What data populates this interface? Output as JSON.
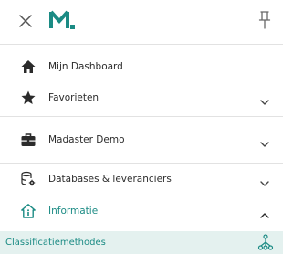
{
  "header": {
    "close_icon": "close-icon",
    "logo_icon": "madaster-logo",
    "pin_icon": "pin-icon"
  },
  "nav": {
    "dashboard": {
      "label": "Mijn Dashboard",
      "icon": "home-icon"
    },
    "favorites": {
      "label": "Favorieten",
      "icon": "star-icon",
      "expanded": false
    },
    "madaster_demo": {
      "label": "Madaster Demo",
      "icon": "briefcase-icon",
      "expanded": false
    },
    "databases": {
      "label": "Databases & leveranciers",
      "icon": "database-settings-icon",
      "expanded": false
    },
    "informatie": {
      "label": "Informatie",
      "icon": "info-home-icon",
      "expanded": true
    },
    "classificatie": {
      "label": "Classificatiemethodes",
      "icon": "hierarchy-icon"
    }
  },
  "colors": {
    "accent": "#1b8b84",
    "active_bg": "#e4f1ef",
    "text": "#2b2b2b",
    "divider": "#e2e2e2"
  }
}
